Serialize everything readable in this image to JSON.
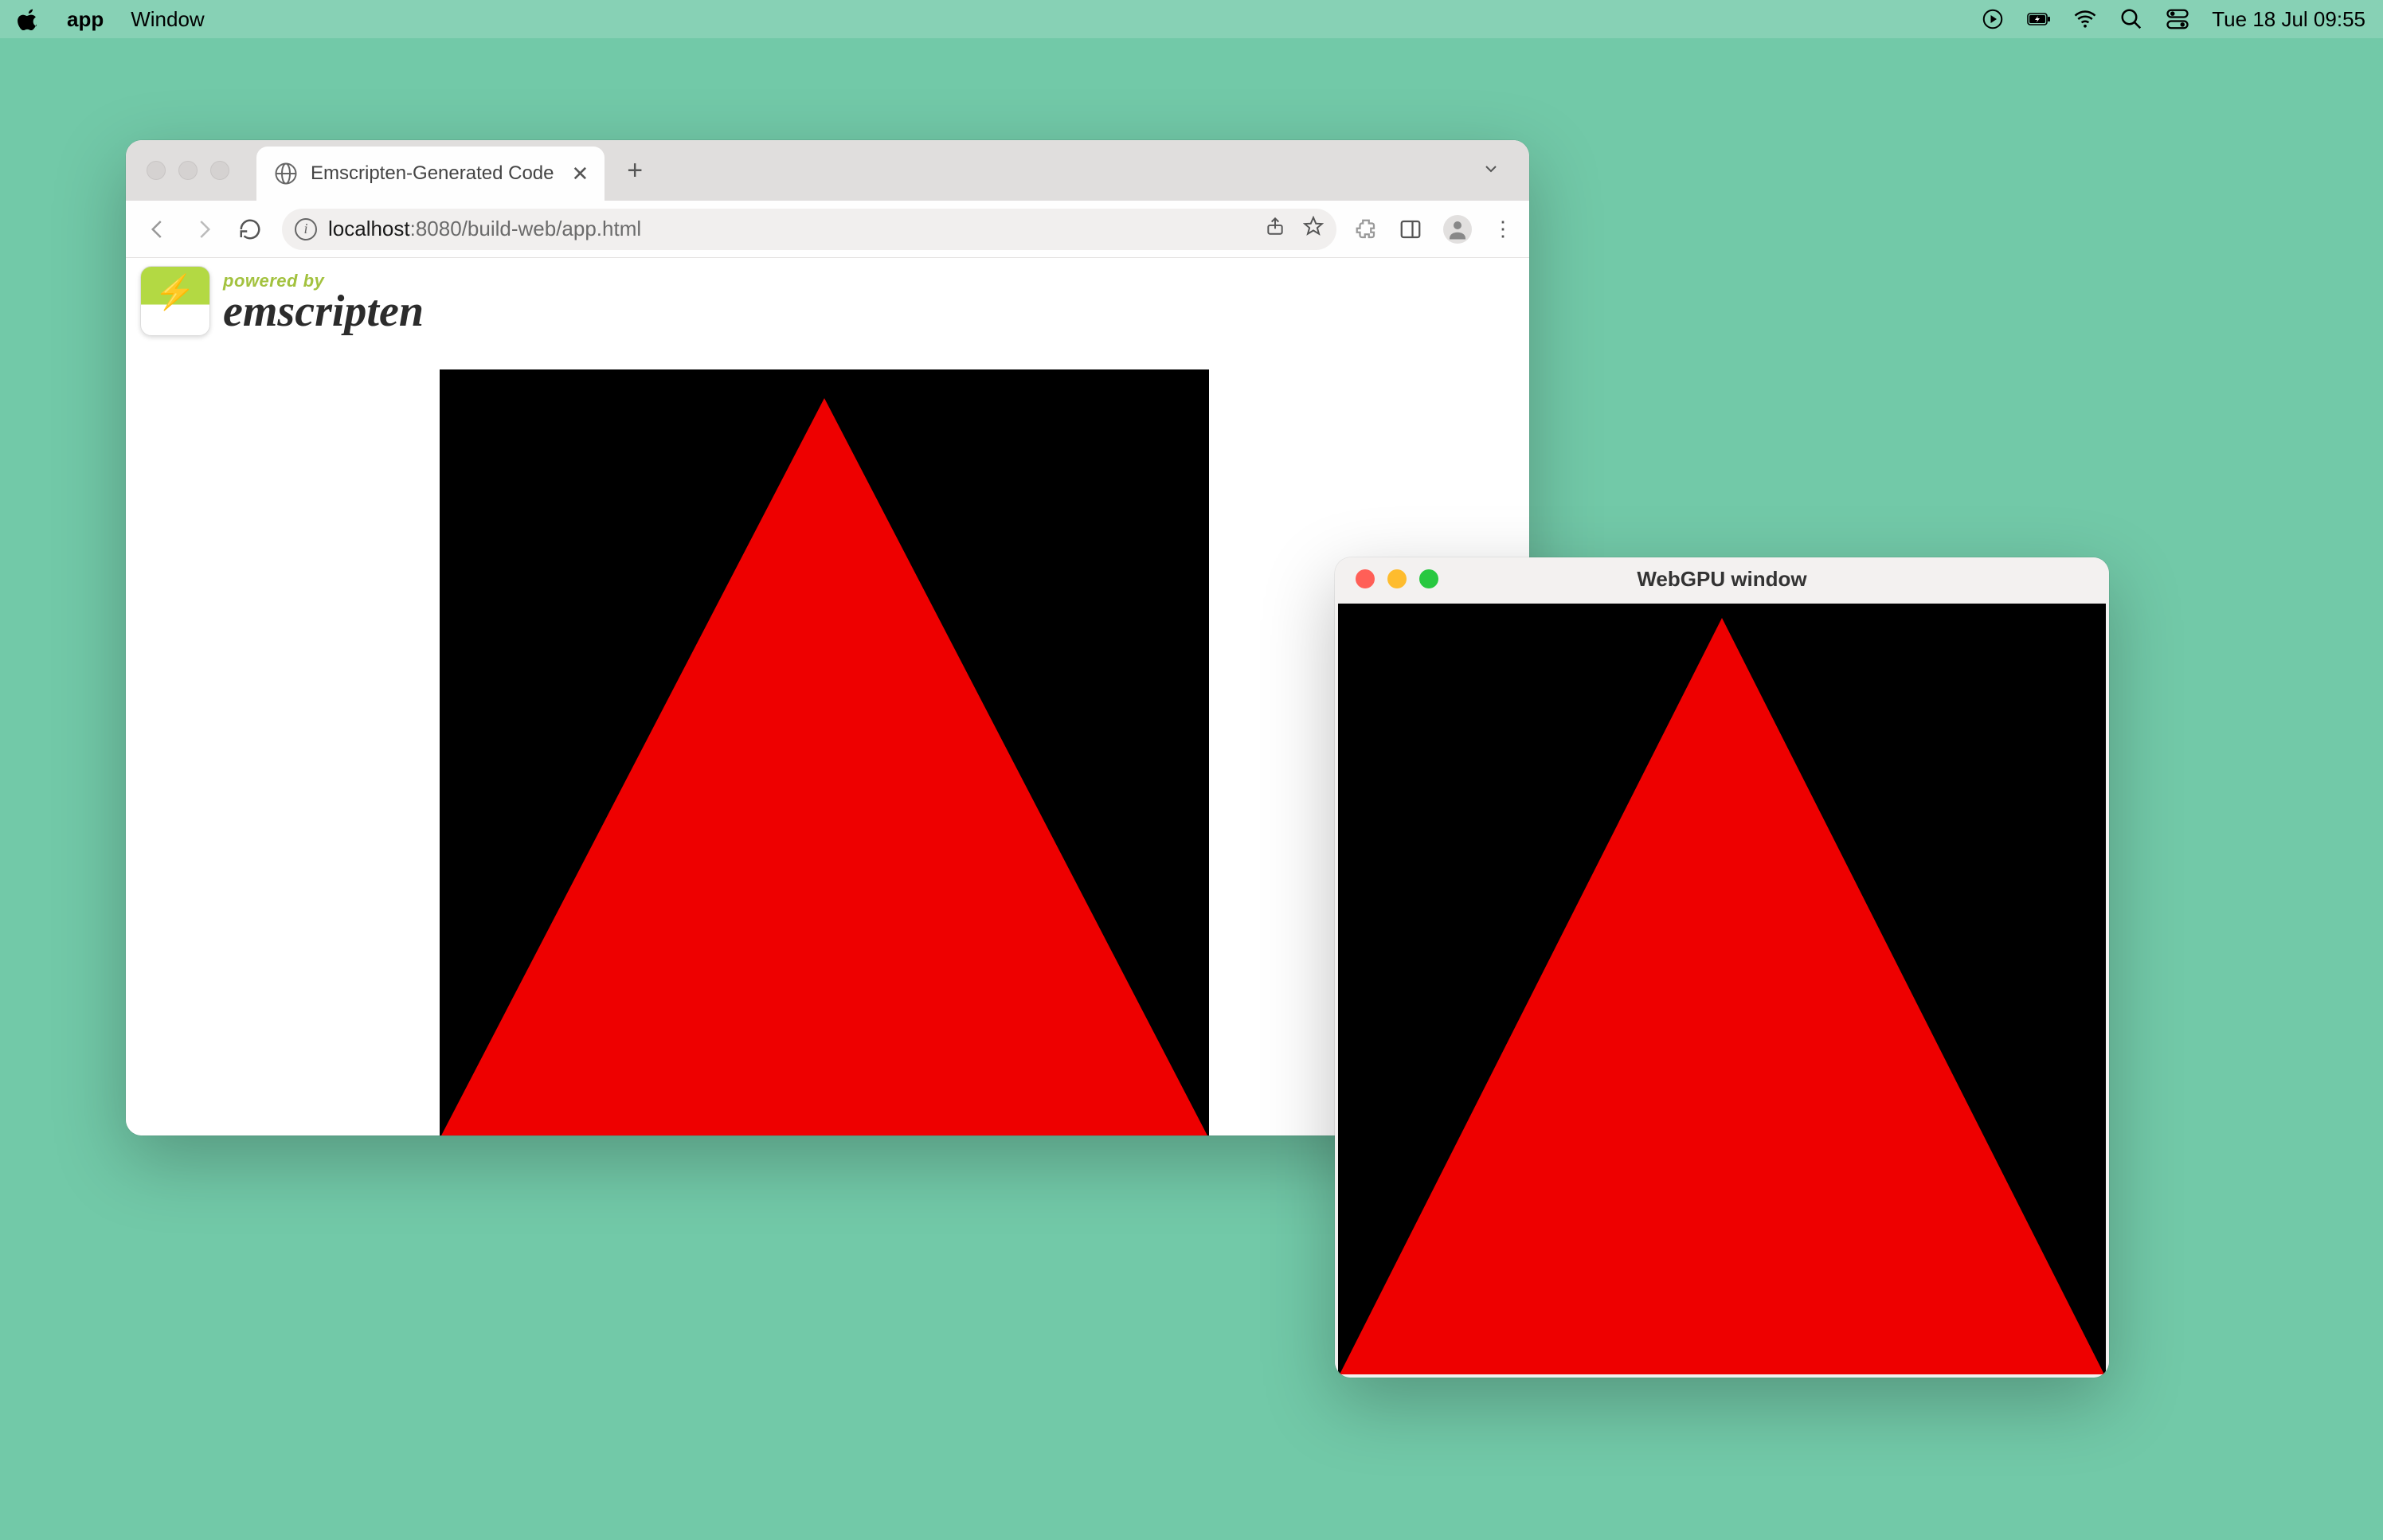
{
  "menubar": {
    "app_name": "app",
    "menu_window": "Window",
    "clock": "Tue 18 Jul  09:55"
  },
  "browser": {
    "tab_title": "Emscripten-Generated Code",
    "url_host": "localhost",
    "url_path": ":8080/build-web/app.html",
    "emscripten_powered": "powered by",
    "emscripten_name": "emscripten"
  },
  "native": {
    "title": "WebGPU window"
  }
}
